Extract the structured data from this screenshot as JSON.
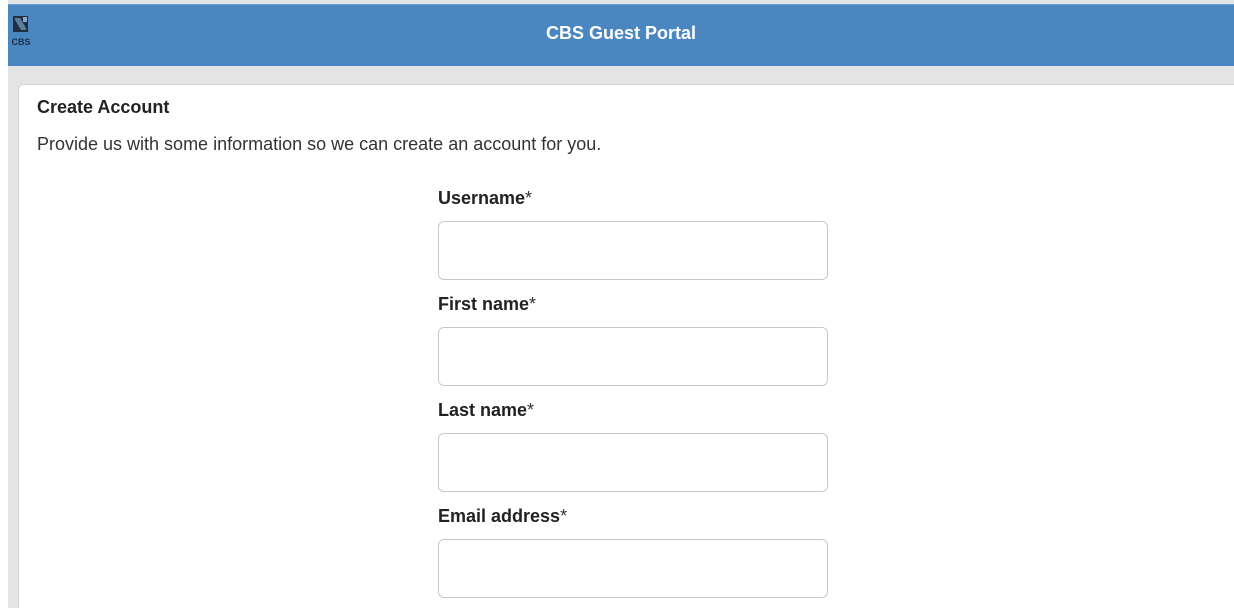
{
  "header": {
    "logo_text": "CBS",
    "title": "CBS Guest Portal"
  },
  "card": {
    "title": "Create Account",
    "description": "Provide us with some information so we can create an account for you."
  },
  "form": {
    "required_marker": "*",
    "fields": [
      {
        "label": "Username",
        "value": "",
        "placeholder": ""
      },
      {
        "label": "First name",
        "value": "",
        "placeholder": ""
      },
      {
        "label": "Last name",
        "value": "",
        "placeholder": ""
      },
      {
        "label": "Email address",
        "value": "",
        "placeholder": ""
      }
    ]
  },
  "colors": {
    "header_bg": "#4a86c0",
    "header_text": "#ffffff",
    "page_bg": "#e4e4e4",
    "card_bg": "#ffffff"
  },
  "icons": {
    "logo": "cbs-logo-icon"
  }
}
